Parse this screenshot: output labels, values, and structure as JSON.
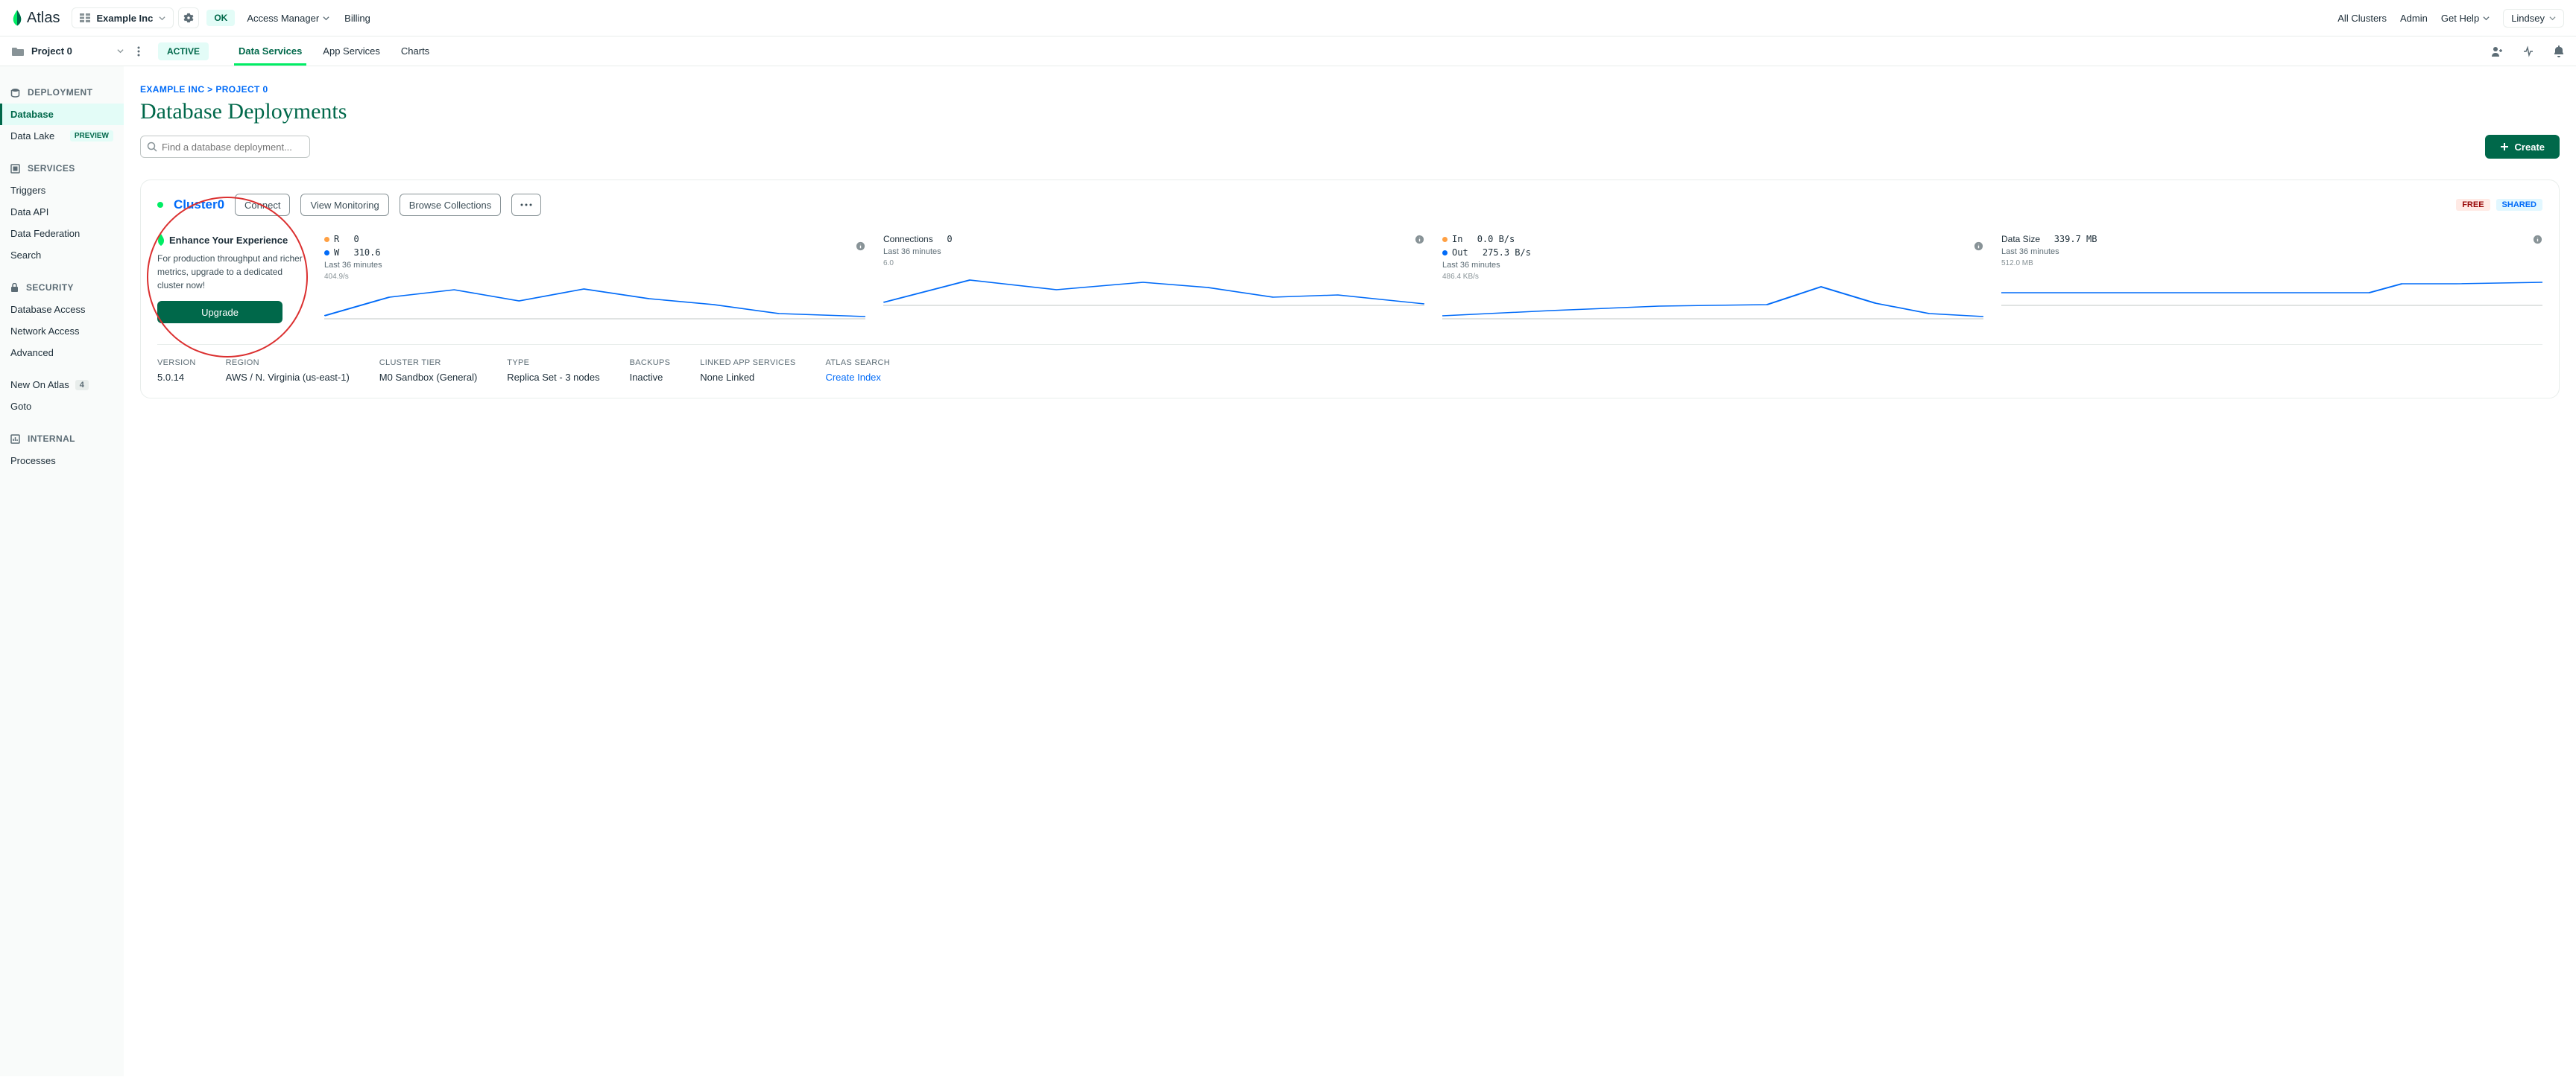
{
  "brand": "Atlas",
  "org": {
    "name": "Example Inc"
  },
  "ok": "OK",
  "top_nav": {
    "access_manager": "Access Manager",
    "billing": "Billing"
  },
  "top_right": {
    "all_clusters": "All Clusters",
    "admin": "Admin",
    "get_help": "Get Help",
    "user": "Lindsey"
  },
  "project": {
    "name": "Project 0",
    "status": "ACTIVE",
    "tabs": {
      "data_services": "Data Services",
      "app_services": "App Services",
      "charts": "Charts"
    }
  },
  "sidebar": {
    "deployment": {
      "label": "DEPLOYMENT",
      "database": "Database",
      "data_lake": "Data Lake",
      "preview": "PREVIEW"
    },
    "services": {
      "label": "SERVICES",
      "triggers": "Triggers",
      "data_api": "Data API",
      "data_federation": "Data Federation",
      "search": "Search"
    },
    "security": {
      "label": "SECURITY",
      "db_access": "Database Access",
      "net_access": "Network Access",
      "advanced": "Advanced"
    },
    "new_on_atlas": {
      "label": "New On Atlas",
      "count": "4"
    },
    "goto": "Goto",
    "internal": {
      "label": "INTERNAL",
      "processes": "Processes"
    }
  },
  "breadcrumb": {
    "org": "EXAMPLE INC",
    "proj": "PROJECT 0"
  },
  "page_title": "Database Deployments",
  "search_placeholder": "Find a database deployment...",
  "create_btn": "Create",
  "cluster": {
    "name": "Cluster0",
    "connect": "Connect",
    "view_monitoring": "View Monitoring",
    "browse_collections": "Browse Collections",
    "free": "FREE",
    "shared": "SHARED",
    "enhance": {
      "title": "Enhance Your Experience",
      "text": "For production throughput and richer metrics, upgrade to a dedicated cluster now!",
      "btn": "Upgrade"
    },
    "metrics": {
      "rw": {
        "r_label": "R",
        "r_val": "0",
        "w_label": "W",
        "w_val": "310.6",
        "sub": "Last 36 minutes",
        "axis": "404.9/s"
      },
      "conn": {
        "label": "Connections",
        "val": "0",
        "sub": "Last 36 minutes",
        "axis": "6.0"
      },
      "io": {
        "in_label": "In",
        "in_val": "0.0 B/s",
        "out_label": "Out",
        "out_val": "275.3 B/s",
        "sub": "Last 36 minutes",
        "axis": "486.4 KB/s"
      },
      "size": {
        "label": "Data Size",
        "val": "339.7 MB",
        "sub": "Last 36 minutes",
        "axis": "512.0 MB"
      }
    },
    "meta": {
      "version": {
        "lbl": "VERSION",
        "val": "5.0.14"
      },
      "region": {
        "lbl": "REGION",
        "val": "AWS / N. Virginia (us-east-1)"
      },
      "tier": {
        "lbl": "CLUSTER TIER",
        "val": "M0 Sandbox (General)"
      },
      "type": {
        "lbl": "TYPE",
        "val": "Replica Set - 3 nodes"
      },
      "backups": {
        "lbl": "BACKUPS",
        "val": "Inactive"
      },
      "linked": {
        "lbl": "LINKED APP SERVICES",
        "val": "None Linked"
      },
      "search": {
        "lbl": "ATLAS SEARCH",
        "val": "Create Index"
      }
    }
  },
  "colors": {
    "green": "#00684A",
    "blue": "#016BF8",
    "orange": "#FFA043"
  }
}
